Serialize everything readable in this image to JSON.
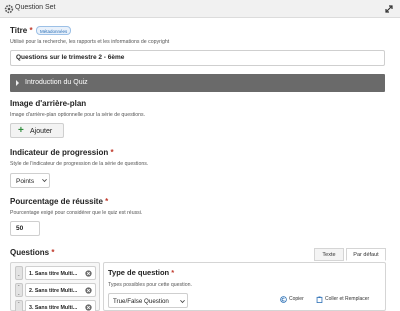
{
  "window": {
    "title": "Question Set"
  },
  "icons": {
    "header": "gear-icon",
    "expand": "expand-icon",
    "add": "plus-icon",
    "remove": "close-icon",
    "copy": "copy-icon",
    "paste": "paste-icon",
    "dropdown": "chevron-down-icon"
  },
  "colors": {
    "required": "#c0392b",
    "accordion_bg": "#6a6a6a",
    "add_icon": "#2e8b3a",
    "badge_text": "#2a6fb5"
  },
  "title_field": {
    "label": "Titre",
    "required_mark": "*",
    "badge": "Métadonnées",
    "description": "Utilisé pour la recherche, les rapports et les informations de copyright",
    "value": "Questions sur le trimestre 2 - 6ème"
  },
  "intro": {
    "label": "Introduction du Quiz"
  },
  "background": {
    "label": "Image d'arrière-plan",
    "description": "Image d'arrière-plan optionnelle pour la série de questions.",
    "add_label": "Ajouter"
  },
  "progress": {
    "label": "Indicateur de progression",
    "required_mark": "*",
    "description": "Style de l'indicateur de progression de la série de questions.",
    "value": "Points"
  },
  "pass": {
    "label": "Pourcentage de réussite",
    "required_mark": "*",
    "description": "Pourcentage exigé pour considérer que le quiz est réussi.",
    "value": "50"
  },
  "questions": {
    "label": "Questions",
    "required_mark": "*",
    "tabs": [
      {
        "label": "Texte",
        "active": false
      },
      {
        "label": "Par défaut",
        "active": true
      }
    ],
    "items": [
      {
        "label": "1. Sans titre Multi..."
      },
      {
        "label": "2. Sans titre Multi..."
      },
      {
        "label": "3. Sans titre Multi..."
      }
    ],
    "type": {
      "label": "Type de question",
      "required_mark": "*",
      "description": "Types possibles pour cette question.",
      "value": "True/False Question"
    },
    "actions": {
      "copy": "Copier",
      "paste": "Coller et Remplacer"
    }
  }
}
